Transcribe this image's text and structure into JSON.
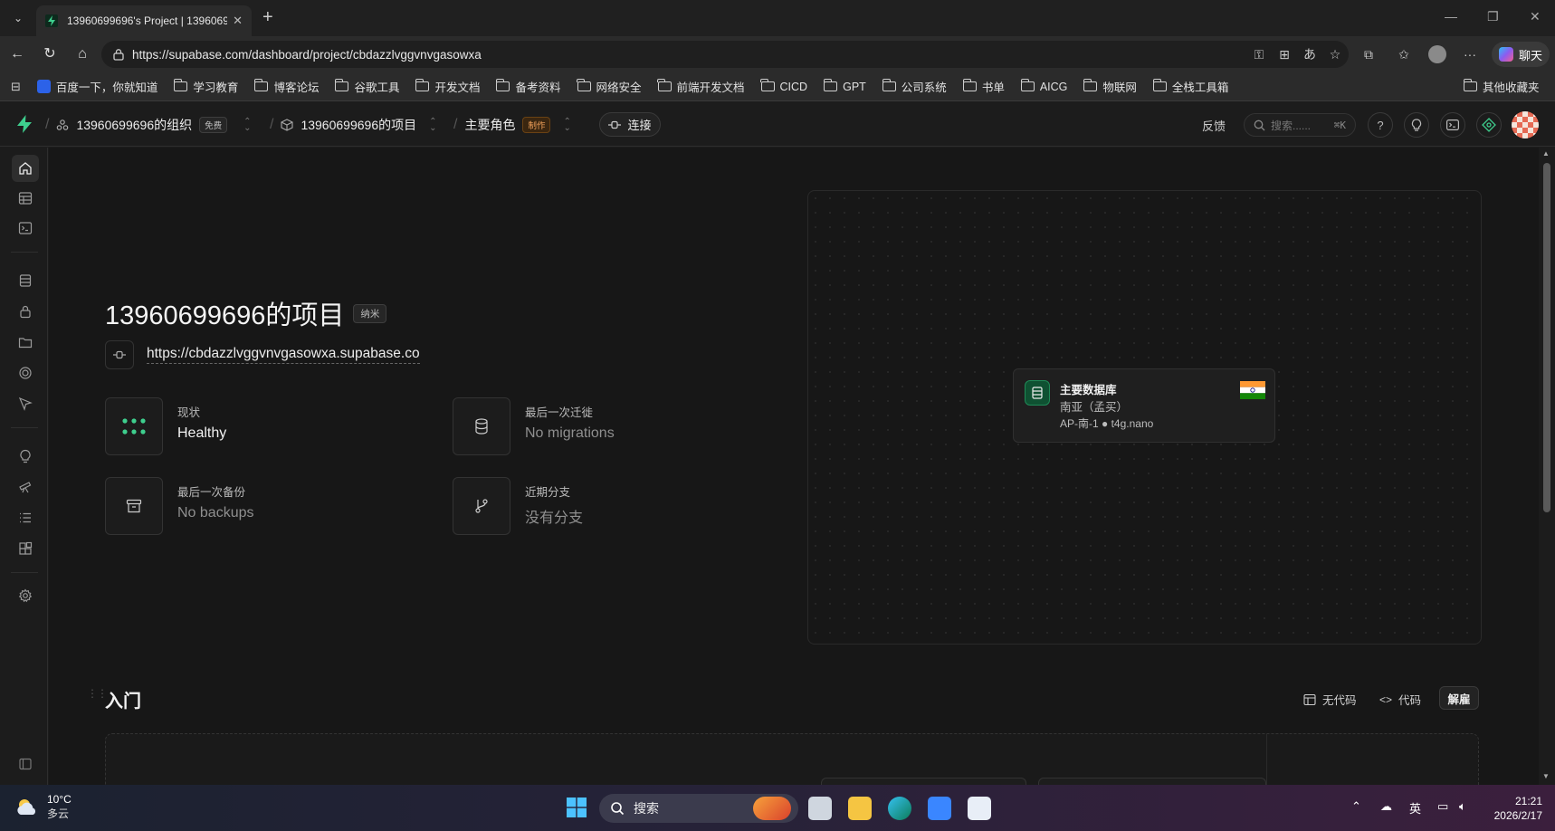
{
  "browser": {
    "tab_title": "13960699696's Project | 13960699",
    "url": "https://supabase.com/dashboard/project/cbdazzlvggvnvgasowxa",
    "chat_label": "聊天",
    "bookmarks": [
      "百度一下，你就知道",
      "学习教育",
      "博客论坛",
      "谷歌工具",
      "开发文档",
      "备考资料",
      "网络安全",
      "前端开发文档",
      "CICD",
      "GPT",
      "公司系统",
      "书单",
      "AICG",
      "物联网",
      "全栈工具箱"
    ],
    "other_bookmarks": "其他收藏夹"
  },
  "header": {
    "org_name": "13960699696的组织",
    "org_badge": "免费",
    "project_name": "13960699696的项目",
    "role": "主要角色",
    "role_badge": "制作",
    "connect": "连接",
    "feedback": "反馈",
    "search_placeholder": "搜索......",
    "search_shortcut": "⌘K"
  },
  "project": {
    "title": "13960699696的项目",
    "size_badge": "纳米",
    "url": "https://cbdazzlvggvnvgasowxa.supabase.co"
  },
  "stats": {
    "status_label": "现状",
    "status_value": "Healthy",
    "migration_label": "最后一次迁徙",
    "migration_value": "No migrations",
    "backup_label": "最后一次备份",
    "backup_value": "No backups",
    "branch_label": "近期分支",
    "branch_value": "没有分支"
  },
  "database": {
    "name": "主要数据库",
    "region": "南亚（孟买）",
    "spec": "AP-南-1 ● t4g.nano"
  },
  "getting_started": {
    "title": "入门",
    "no_code": "无代码",
    "code": "代码",
    "dismiss": "解雇"
  },
  "taskbar": {
    "temperature": "10°C",
    "weather": "多云",
    "search": "搜索",
    "ime": "英",
    "time": "21:21",
    "date": "2026/2/17"
  },
  "colors": {
    "brand_green": "#3ecf8e",
    "background": "#171717",
    "badge_orange": "#f5a35c"
  }
}
